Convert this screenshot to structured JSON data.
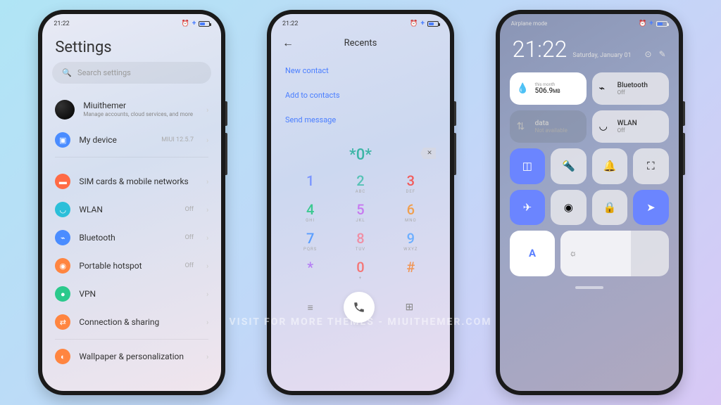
{
  "status": {
    "time": "21:22",
    "plus": "+"
  },
  "settings": {
    "title": "Settings",
    "search_placeholder": "Search settings",
    "account": {
      "name": "Miuithemer",
      "sub": "Manage accounts, cloud services, and more"
    },
    "device": {
      "label": "My device",
      "version": "MIUI 12.5.7"
    },
    "items": [
      {
        "label": "SIM cards & mobile networks",
        "right": ""
      },
      {
        "label": "WLAN",
        "right": "Off"
      },
      {
        "label": "Bluetooth",
        "right": "Off"
      },
      {
        "label": "Portable hotspot",
        "right": "Off"
      },
      {
        "label": "VPN",
        "right": ""
      },
      {
        "label": "Connection & sharing",
        "right": ""
      },
      {
        "label": "Wallpaper & personalization",
        "right": ""
      }
    ]
  },
  "dialer": {
    "title": "Recents",
    "menu": [
      "New contact",
      "Add to contacts",
      "Send message"
    ],
    "display": "*0*",
    "keys": [
      {
        "n": "1",
        "s": ""
      },
      {
        "n": "2",
        "s": "ABC"
      },
      {
        "n": "3",
        "s": "DEF"
      },
      {
        "n": "4",
        "s": "GHI"
      },
      {
        "n": "5",
        "s": "JKL"
      },
      {
        "n": "6",
        "s": "MNO"
      },
      {
        "n": "7",
        "s": "PQRS"
      },
      {
        "n": "8",
        "s": "TUV"
      },
      {
        "n": "9",
        "s": "WXYZ"
      },
      {
        "n": "*",
        "s": ""
      },
      {
        "n": "0",
        "s": "+"
      },
      {
        "n": "#",
        "s": ""
      }
    ]
  },
  "cc": {
    "airplane": "Airplane mode",
    "time": "21:22",
    "date": "Saturday, January 01",
    "data": {
      "label": "this month",
      "value": "506.9",
      "unit": "MB"
    },
    "bluetooth": {
      "label": "Bluetooth",
      "state": "Off"
    },
    "mobile": {
      "label": "data",
      "state": "Not available"
    },
    "wlan": {
      "label": "WLAN",
      "state": "Off"
    }
  },
  "watermark": "VISIT FOR MORE THEMES - MIUITHEMER.COM"
}
